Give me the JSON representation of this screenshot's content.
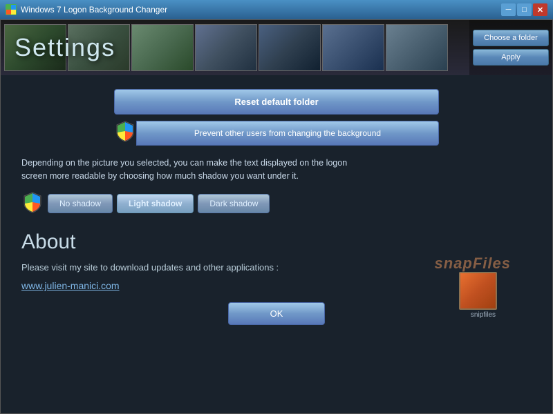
{
  "titlebar": {
    "title": "Windows 7 Logon Background Changer",
    "minimize": "─",
    "maximize": "□",
    "close": "✕"
  },
  "sidebar": {
    "choose_folder": "Choose a folder",
    "apply": "Apply",
    "settings_tab": "Settings"
  },
  "settings": {
    "title": "Settings",
    "reset_btn": "Reset default folder",
    "prevent_btn": "Prevent other users from changing the background",
    "shadow_desc": "Depending on the picture you selected, you can make the text displayed on the logon screen more readable by choosing how much shadow you want under it.",
    "no_shadow": "No shadow",
    "light_shadow": "Light shadow",
    "dark_shadow": "Dark shadow"
  },
  "about": {
    "title": "About",
    "text": "Please visit my site to download updates and other applications :",
    "link": "www.julien-manici.com"
  },
  "ok_btn": "OK",
  "snapfiles": {
    "label": "snapFiles",
    "icon_label": "snipfiles"
  }
}
